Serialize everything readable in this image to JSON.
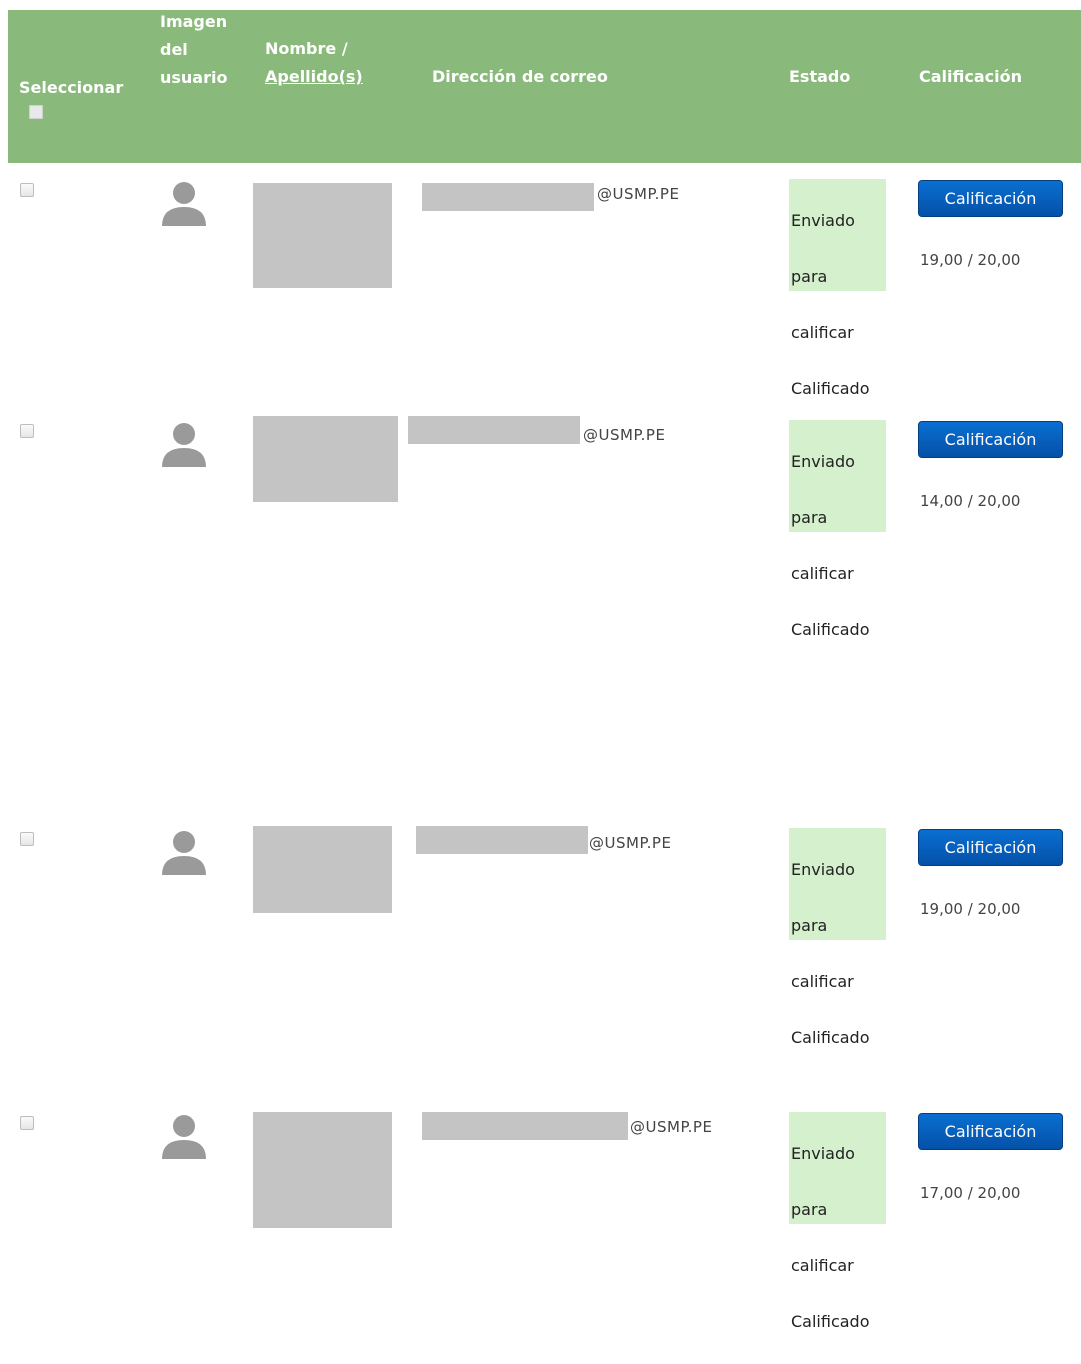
{
  "table": {
    "headers": {
      "select": "Seleccionar",
      "image_line1": "Imagen",
      "image_line2": "del",
      "image_line3": "usuario",
      "name_line1": "Nombre /",
      "name_sort": "Apellido(s)",
      "email": "Dirección de correo",
      "status": "Estado",
      "grade": "Calificación"
    },
    "rows": [
      {
        "email_domain": "@USMP.PE",
        "status_line1": "Enviado",
        "status_line2": "para",
        "status_line3": "calificar",
        "status_line4": "Calificado",
        "grade_button": "Calificación",
        "grade_value": "19,00 / 20,00"
      },
      {
        "email_domain": "@USMP.PE",
        "status_line1": "Enviado",
        "status_line2": "para",
        "status_line3": "calificar",
        "status_line4": "Calificado",
        "grade_button": "Calificación",
        "grade_value": "14,00 / 20,00"
      },
      {
        "email_domain": "@USMP.PE",
        "status_line1": "Enviado",
        "status_line2": "para",
        "status_line3": "calificar",
        "status_line4": "Calificado",
        "grade_button": "Calificación",
        "grade_value": "19,00 / 20,00"
      },
      {
        "email_domain": "@USMP.PE",
        "status_line1": "Enviado",
        "status_line2": "para",
        "status_line3": "calificar",
        "status_line4": "Calificado",
        "grade_button": "Calificación",
        "grade_value": "17,00 / 20,00"
      }
    ]
  },
  "icons": {
    "avatar": "user-icon",
    "checkbox": "checkbox-icon"
  },
  "colors": {
    "header_bg": "#8aba7b",
    "status_bg": "#d4f0cd",
    "button_bg": "#0451a8"
  }
}
